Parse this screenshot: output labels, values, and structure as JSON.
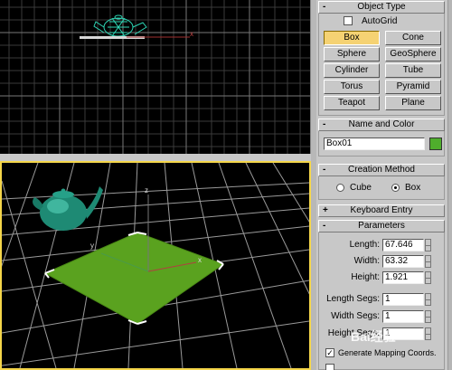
{
  "viewports": {
    "top_axis": "x",
    "persp_axis_z": "z",
    "persp_axis_x": "x",
    "persp_axis_y": "y"
  },
  "panel": {
    "object_type": {
      "title": "Object Type",
      "sign": "-",
      "autogrid_label": "AutoGrid",
      "buttons": [
        "Box",
        "Cone",
        "Sphere",
        "GeoSphere",
        "Cylinder",
        "Tube",
        "Torus",
        "Pyramid",
        "Teapot",
        "Plane"
      ]
    },
    "name_color": {
      "title": "Name and Color",
      "sign": "-",
      "name_value": "Box01",
      "color": "#4fae2c"
    },
    "creation_method": {
      "title": "Creation Method",
      "sign": "-",
      "option_cube": "Cube",
      "option_box": "Box",
      "selected": "Box"
    },
    "keyboard_entry": {
      "title": "Keyboard Entry",
      "sign": "+"
    },
    "parameters": {
      "title": "Parameters",
      "sign": "-",
      "length_label": "Length:",
      "length_value": "67.646",
      "width_label": "Width:",
      "width_value": "63.32",
      "height_label": "Height:",
      "height_value": "1.921",
      "length_segs_label": "Length Segs:",
      "length_segs_value": "1",
      "width_segs_label": "Width Segs:",
      "width_segs_value": "1",
      "height_segs_label": "Height Segs:",
      "height_segs_value": "1",
      "gen_mapping_label": "Generate Mapping Coords."
    }
  },
  "watermark": "Bai经验"
}
